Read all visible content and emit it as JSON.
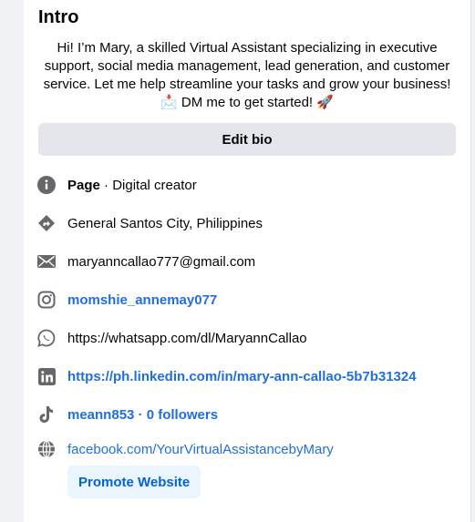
{
  "intro": {
    "title": "Intro",
    "bio_text": "Hi! I’m Mary, a skilled Virtual Assistant specializing in executive support, social media management, lead generation, and customer service. Let me help streamline your tasks and grow your business!",
    "bio_cta": "DM me to get started!",
    "bio_cta_emoji_before": "📩",
    "bio_cta_emoji_after": "🚀",
    "edit_bio_label": "Edit bio"
  },
  "details": {
    "page_label": "Page",
    "page_separator": " · ",
    "page_category": "Digital creator",
    "location": "General Santos City, Philippines",
    "email": "maryanncallao777@gmail.com",
    "instagram": "momshie_annemay077",
    "whatsapp": "https://whatsapp.com/dl/MaryannCallao",
    "linkedin": "https://ph.linkedin.com/in/mary-ann-callao-5b7b31324",
    "tiktok": "meann853 · 0 followers",
    "website": "facebook.com/YourVirtualAssistancebyMary",
    "promote_label": "Promote Website"
  },
  "colors": {
    "link": "#216fdb",
    "icon": "#65676b",
    "button_bg": "#e4e6eb",
    "promote_bg": "#ebf5ff"
  },
  "icons": [
    "info-icon",
    "location-arrow-icon",
    "mail-icon",
    "instagram-icon",
    "whatsapp-icon",
    "linkedin-icon",
    "tiktok-icon",
    "globe-icon"
  ]
}
